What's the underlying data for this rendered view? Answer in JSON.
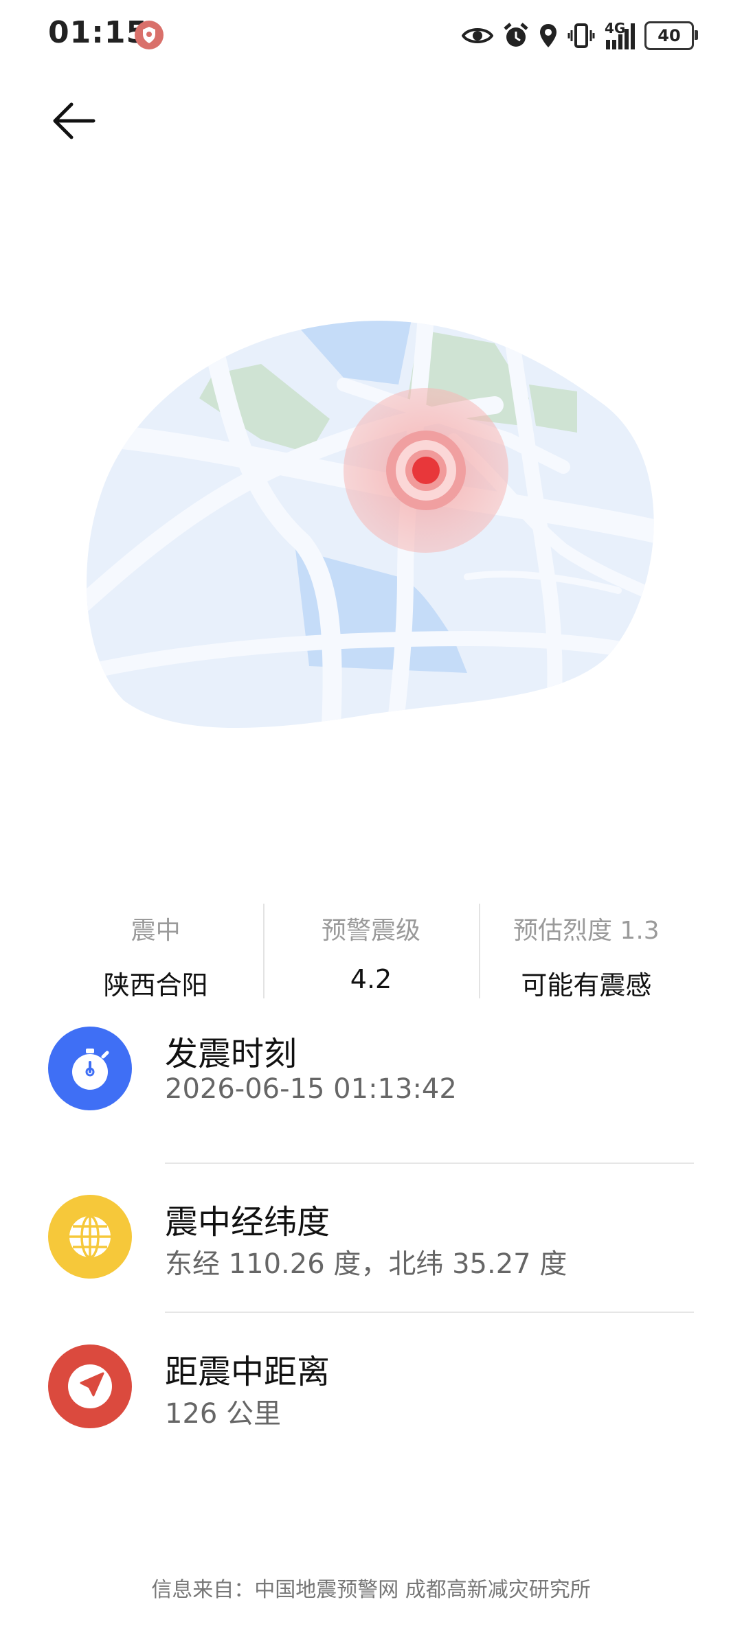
{
  "status_bar": {
    "time": "01:15",
    "network": "4G",
    "battery": "40",
    "icons": [
      "shield-icon",
      "eye-icon",
      "alarm-icon",
      "location-icon",
      "vibrate-icon",
      "signal-icon",
      "battery-icon"
    ]
  },
  "summary": {
    "epicenter_label": "震中",
    "epicenter_value": "陕西合阳",
    "magnitude_label": "预警震级",
    "magnitude_value": "4.2",
    "intensity_label": "预估烈度 1.3",
    "intensity_value": "可能有震感"
  },
  "details": [
    {
      "title": "发震时刻",
      "value": "2026-06-15 01:13:42",
      "icon": "stopwatch-icon",
      "color": "#3f6ff5"
    },
    {
      "title": "震中经纬度",
      "value": "东经 110.26 度，北纬 35.27 度",
      "icon": "globe-icon",
      "color": "#f6c83a"
    },
    {
      "title": "距震中距离",
      "value": "126 公里",
      "icon": "navigation-arrow-icon",
      "color": "#db4a3e"
    }
  ],
  "footer": "信息来自：中国地震预警网 成都高新减灾研究所",
  "colors": {
    "map_land": "#e8f0fb",
    "map_water": "#c5dcf8",
    "map_park": "#cfe3d3",
    "epicenter_red": "#e8373a"
  }
}
